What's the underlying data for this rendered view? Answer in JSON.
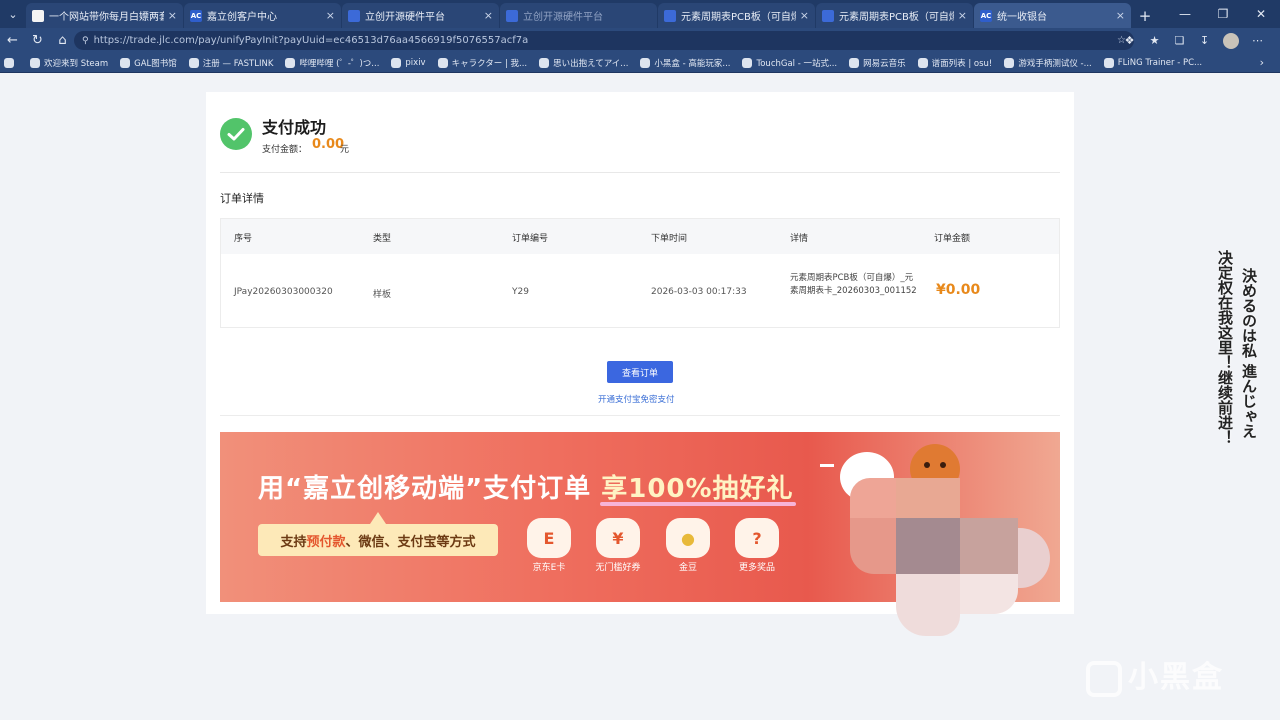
{
  "browser": {
    "tabs": [
      {
        "title": "一个网站带你每月白嫖两套PCB小",
        "icon": "white",
        "active": false
      },
      {
        "title": "嘉立创客户中心",
        "icon": "ac",
        "active": false
      },
      {
        "title": "立创开源硬件平台",
        "icon": "blue",
        "active": false
      },
      {
        "title": "立创开源硬件平台",
        "icon": "blue",
        "active": false,
        "dim": true
      },
      {
        "title": "元素周期表PCB板（可自爆）- 立",
        "icon": "blue",
        "active": false
      },
      {
        "title": "元素周期表PCB板（可自爆）| 元",
        "icon": "blue",
        "active": false
      },
      {
        "title": "统一收银台",
        "icon": "ac",
        "active": true
      }
    ],
    "url": "https://trade.jlc.com/pay/unifyPayInit?payUuid=ec46513d76aa4566919f5076557acf7a",
    "bookmarks": [
      "欢迎来到 Steam",
      "GAL图书馆",
      "注册 — FASTLINK",
      "哔哩哔哩 (゜-゜)つ...",
      "pixiv",
      "キャラクター | 我...",
      "思い出抱えてアイ...",
      "小黑盒 - 高能玩家...",
      "TouchGal - 一站式...",
      "网易云音乐",
      "谱面列表 | osu!",
      "游戏手柄测试仪 -...",
      "FLiNG Trainer - PC..."
    ]
  },
  "success": {
    "title": "支付成功",
    "amount_label": "支付金额：",
    "amount": "0.00",
    "unit": "元"
  },
  "order": {
    "section_title": "订单详情",
    "headers": [
      "序号",
      "类型",
      "订单编号",
      "下单时间",
      "详情",
      "订单金额"
    ],
    "row": {
      "serial": "JPay20260303000320",
      "type": "样板",
      "order_no": "Y29",
      "time": "2026-03-03 00:17:33",
      "detail": "元素周期表PCB板（可自爆）_元素周期表卡_20260303_001152",
      "amount": "¥0.00"
    }
  },
  "actions": {
    "view_order": "查看订单",
    "enable_pay": "开通支付宝免密支付"
  },
  "banner": {
    "headline_pre": "用“嘉立创移动端”支付订单 ",
    "headline_hl": "享100%抽好礼",
    "pill_pre": "支持",
    "pill_hl": "预付款",
    "pill_post": "、微信、支付宝等方式",
    "prizes": [
      "京东E卡",
      "无门槛好券",
      "金豆",
      "更多奖品"
    ]
  },
  "caption": {
    "col1": "決めるのは私 進んじゃえ",
    "col2": "决定权在我这里！继续前进！"
  },
  "watermark": "小黑盒"
}
